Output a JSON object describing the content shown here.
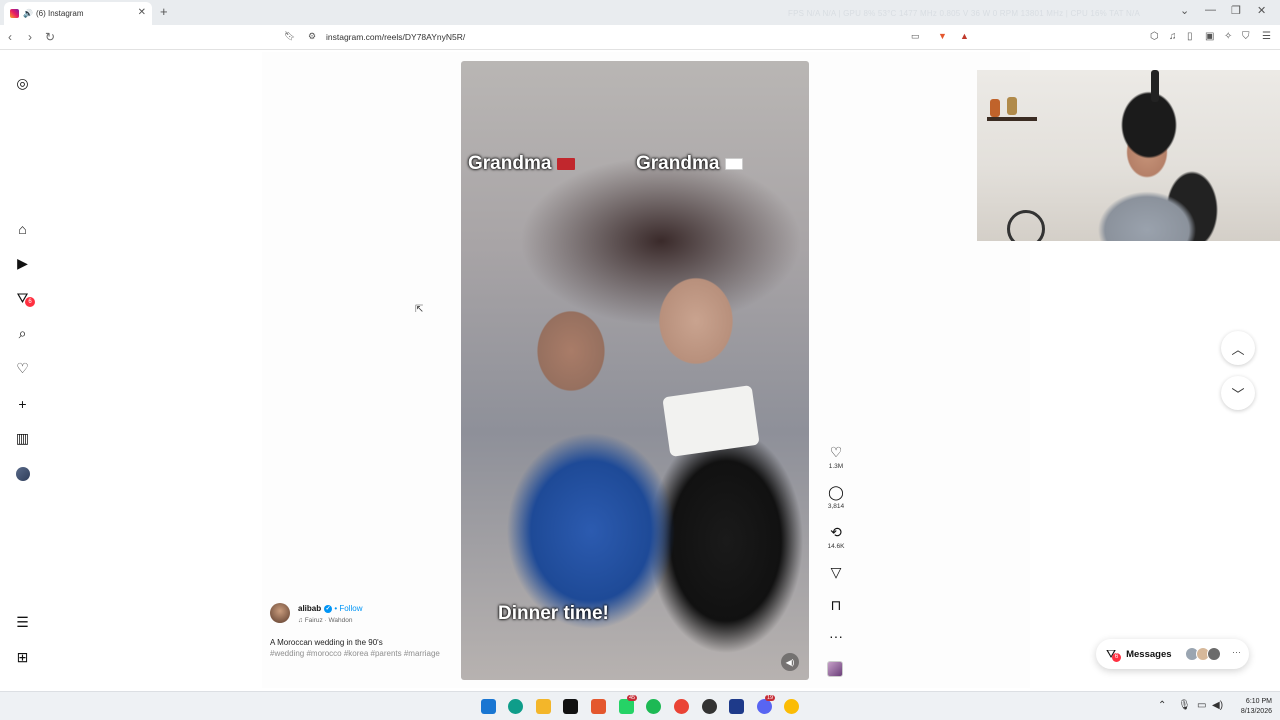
{
  "browser": {
    "tab_title": "(6) Instagram",
    "tab_audio_icon": "speaker-icon",
    "new_tab": "+",
    "perf_overlay": "FPS N/A  N/A  |  GPU 8%  53°C 1477 MHz 0.805 V 36 W 0 RPM 13801 MHz  |  CPU 16%  TAT  N/A",
    "url": "instagram.com/reels/DY78AYnyN5R/"
  },
  "sidebar": {
    "notifications_badge": "6"
  },
  "video": {
    "label_left": "Grandma",
    "label_right": "Grandma",
    "caption_overlay": "Dinner time!",
    "mute_icon": "speaker-icon"
  },
  "actions": {
    "likes": "1.3M",
    "comments": "3,814",
    "reposts": "14.6K"
  },
  "caption": {
    "username": "alibab",
    "follow": "Follow",
    "audio": "Fairuz · Wahdon",
    "text": "A Moroccan wedding in the 90's",
    "tags": "#wedding #morocco #korea #parents #marriage"
  },
  "messages": {
    "label": "Messages",
    "badge": "6",
    "more": "···"
  },
  "taskbar": {
    "whatsapp_badge": "45",
    "discord_badge": "19",
    "time": "6:10 PM",
    "date": "8/13/2026"
  },
  "colors": {
    "accent": "#0095f6",
    "badge": "#ff3040"
  }
}
